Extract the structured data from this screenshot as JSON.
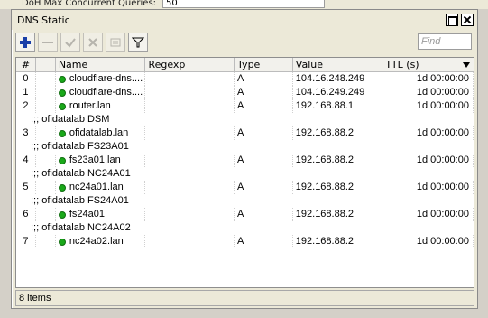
{
  "background": {
    "label": "DoH Max Concurrent Queries:",
    "value": "50"
  },
  "window": {
    "title": "DNS Static"
  },
  "toolbar": {
    "add": "add-icon",
    "remove": "remove-icon",
    "enable": "enable-icon",
    "disable": "disable-icon",
    "comment": "comment-icon",
    "filter": "filter-icon",
    "find_placeholder": "Find"
  },
  "table": {
    "columns": [
      "#",
      "",
      "Name",
      "Regexp",
      "Type",
      "Value",
      "TTL (s)"
    ],
    "rows": [
      {
        "kind": "entry",
        "num": "0",
        "name": "cloudflare-dns....",
        "regexp": "",
        "type": "A",
        "value": "104.16.248.249",
        "ttl": "1d 00:00:00"
      },
      {
        "kind": "entry",
        "num": "1",
        "name": "cloudflare-dns....",
        "regexp": "",
        "type": "A",
        "value": "104.16.249.249",
        "ttl": "1d 00:00:00"
      },
      {
        "kind": "entry",
        "num": "2",
        "name": "router.lan",
        "regexp": "",
        "type": "A",
        "value": "192.168.88.1",
        "ttl": "1d 00:00:00"
      },
      {
        "kind": "comment",
        "text": ";;; ofidatalab DSM"
      },
      {
        "kind": "entry",
        "num": "3",
        "name": "ofidatalab.lan",
        "regexp": "",
        "type": "A",
        "value": "192.168.88.2",
        "ttl": "1d 00:00:00"
      },
      {
        "kind": "comment",
        "text": ";;; ofidatalab FS23A01"
      },
      {
        "kind": "entry",
        "num": "4",
        "name": "fs23a01.lan",
        "regexp": "",
        "type": "A",
        "value": "192.168.88.2",
        "ttl": "1d 00:00:00"
      },
      {
        "kind": "comment",
        "text": ";;; ofidatalab NC24A01"
      },
      {
        "kind": "entry",
        "num": "5",
        "name": "nc24a01.lan",
        "regexp": "",
        "type": "A",
        "value": "192.168.88.2",
        "ttl": "1d 00:00:00"
      },
      {
        "kind": "comment",
        "text": ";;; ofidatalab FS24A01"
      },
      {
        "kind": "entry",
        "num": "6",
        "name": "fs24a01",
        "regexp": "",
        "type": "A",
        "value": "192.168.88.2",
        "ttl": "1d 00:00:00"
      },
      {
        "kind": "comment",
        "text": ";;; ofidatalab NC24A02"
      },
      {
        "kind": "entry",
        "num": "7",
        "name": "nc24a02.lan",
        "regexp": "",
        "type": "A",
        "value": "192.168.88.2",
        "ttl": "1d 00:00:00"
      }
    ]
  },
  "status": {
    "items": "8 items"
  },
  "colors": {
    "enabled_dot": "#19a819",
    "add_icon": "#1a3fa8"
  }
}
